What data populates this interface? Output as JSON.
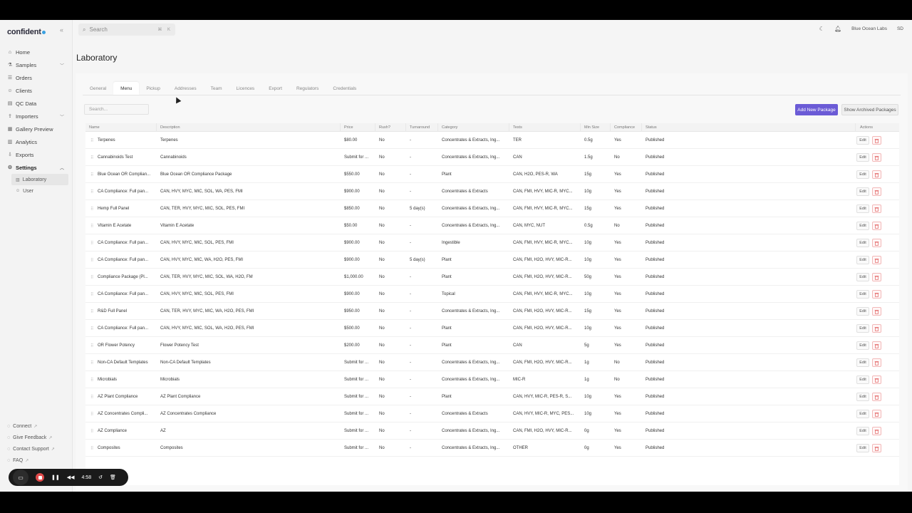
{
  "app": {
    "logo": "confident",
    "workspace": "Blue Ocean Labs",
    "user_initials": "SD"
  },
  "search": {
    "placeholder": "Search",
    "shortcut": "⌘ K"
  },
  "sidebar": {
    "items": [
      {
        "label": "Home",
        "icon": "home-icon"
      },
      {
        "label": "Samples",
        "icon": "flask-icon",
        "chevron": true
      },
      {
        "label": "Orders",
        "icon": "orders-icon"
      },
      {
        "label": "Clients",
        "icon": "clients-icon"
      },
      {
        "label": "QC Data",
        "icon": "qc-icon"
      },
      {
        "label": "Importers",
        "icon": "importers-icon",
        "chevron": true
      },
      {
        "label": "Gallery Preview",
        "icon": "gallery-icon"
      },
      {
        "label": "Analytics",
        "icon": "analytics-icon"
      },
      {
        "label": "Exports",
        "icon": "exports-icon"
      },
      {
        "label": "Settings",
        "icon": "gear-icon",
        "chevron": true,
        "active": true
      }
    ],
    "sub_items": [
      {
        "label": "Laboratory",
        "active": true
      },
      {
        "label": "User"
      }
    ],
    "footer": [
      {
        "label": "Connect"
      },
      {
        "label": "Give Feedback"
      },
      {
        "label": "Contact Support"
      },
      {
        "label": "FAQ"
      }
    ]
  },
  "page": {
    "title": "Laboratory"
  },
  "tabs": [
    "General",
    "Menu",
    "Pickup",
    "Addresses",
    "Team",
    "Licences",
    "Export",
    "Regulators",
    "Credentials"
  ],
  "active_tab": "Menu",
  "toolbar": {
    "search_placeholder": "Search...",
    "add_label": "Add New Package",
    "archived_label": "Show Archived Packages"
  },
  "table": {
    "columns": [
      "Name",
      "Description",
      "Price",
      "Rush?",
      "Turnaround",
      "Category",
      "Tests",
      "Min Size",
      "Compliance",
      "Status",
      "Actions"
    ],
    "edit_label": "Edit",
    "rows": [
      [
        "Terpenes",
        "Terpenes",
        "$80.00",
        "No",
        "-",
        "Concentrates & Extracts, Ing...",
        "TER",
        "0.5g",
        "Yes",
        "Published"
      ],
      [
        "Cannabinoids Test",
        "Cannabinoids",
        "Submit for ...",
        "No",
        "-",
        "Concentrates & Extracts, Ing...",
        "CAN",
        "1.5g",
        "No",
        "Published"
      ],
      [
        "Blue Ocean OR Complian...",
        "Blue Ocean OR Compliance Package",
        "$550.00",
        "No",
        "-",
        "Plant",
        "CAN, H2O, PES-R, WA",
        "15g",
        "Yes",
        "Published"
      ],
      [
        "CA Compliance: Full pan...",
        "CAN, HVY, MYC, MIC, SOL, WA, PES, FMI",
        "$900.00",
        "No",
        "-",
        "Concentrates & Extracts",
        "CAN, FMI, HVY, MIC-R, MYC...",
        "10g",
        "Yes",
        "Published"
      ],
      [
        "Hemp Full Panel",
        "CAN, TER, HVY, MYC, MIC, SOL, PES, FMI",
        "$850.00",
        "No",
        "5 day(s)",
        "Concentrates & Extracts, Ing...",
        "CAN, FMI, HVY, MIC-R, MYC...",
        "15g",
        "Yes",
        "Published"
      ],
      [
        "Vitamin E Acetate",
        "Vitamin E Acetate",
        "$50.00",
        "No",
        "-",
        "Concentrates & Extracts, Ing...",
        "CAN, MYC, NUT",
        "0.5g",
        "No",
        "Published"
      ],
      [
        "CA Compliance: Full pan...",
        "CAN, HVY, MYC, MIC, SOL, PES, FMI",
        "$900.00",
        "No",
        "-",
        "Ingestible",
        "CAN, FMI, HVY, MIC-R, MYC...",
        "10g",
        "Yes",
        "Published"
      ],
      [
        "CA Compliance: Full pan...",
        "CAN, HVY, MYC, MIC, WA, H2O, PES, FMI",
        "$900.00",
        "No",
        "5 day(s)",
        "Plant",
        "CAN, FMI, H2O, HVY, MIC-R...",
        "10g",
        "Yes",
        "Published"
      ],
      [
        "Compliance Package (Pl...",
        "CAN, TER, HVY, MYC, MIC, SOL, WA, H2O, FM",
        "$1,000.00",
        "No",
        "-",
        "Plant",
        "CAN, FMI, H2O, HVY, MIC-R...",
        "50g",
        "Yes",
        "Published"
      ],
      [
        "CA Compliance: Full pan...",
        "CAN, HVY, MYC, MIC, SOL, PES, FMI",
        "$900.00",
        "No",
        "-",
        "Topical",
        "CAN, FMI, HVY, MIC-R, MYC...",
        "10g",
        "Yes",
        "Published"
      ],
      [
        "R&D Full Panel",
        "CAN, TER, HVY, MYC, MIC, WA, H2O, PES, FMI",
        "$950.00",
        "No",
        "-",
        "Concentrates & Extracts, Ing...",
        "CAN, FMI, H2O, HVY, MIC-R...",
        "15g",
        "Yes",
        "Published"
      ],
      [
        "CA Compliance: Full pan...",
        "CAN, HVY, MYC, MIC, SOL, WA, H2O, PES, FMI",
        "$500.00",
        "No",
        "-",
        "Plant",
        "CAN, FMI, H2O, HVY, MIC-R...",
        "10g",
        "Yes",
        "Published"
      ],
      [
        "OR Flower Potency",
        "Flower Potency Test",
        "$200.00",
        "No",
        "-",
        "Plant",
        "CAN",
        "5g",
        "Yes",
        "Published"
      ],
      [
        "Non-CA Default Templates",
        "Non-CA Default Templates",
        "Submit for ...",
        "No",
        "-",
        "Concentrates & Extracts, Ing...",
        "CAN, FMI, H2O, HVY, MIC-R...",
        "1g",
        "No",
        "Published"
      ],
      [
        "Microbials",
        "Microbials",
        "Submit for ...",
        "No",
        "-",
        "Concentrates & Extracts, Ing...",
        "MIC-R",
        "1g",
        "No",
        "Published"
      ],
      [
        "AZ Plant Compliance",
        "AZ Plant Compliance",
        "Submit for ...",
        "No",
        "-",
        "Plant",
        "CAN, HVY, MIC-R, PES-R, S...",
        "10g",
        "Yes",
        "Published"
      ],
      [
        "AZ Concentrates Compli...",
        "AZ Concentrates Compliance",
        "Submit for ...",
        "No",
        "-",
        "Concentrates & Extracts",
        "CAN, HVY, MIC-R, MYC, PES...",
        "10g",
        "Yes",
        "Published"
      ],
      [
        "AZ Compliance",
        "AZ",
        "Submit for ...",
        "No",
        "-",
        "Concentrates & Extracts, Ing...",
        "CAN, FMI, H2O, HVY, MIC-R...",
        "0g",
        "Yes",
        "Published"
      ],
      [
        "Composites",
        "Composites",
        "Submit for ...",
        "No",
        "-",
        "Concentrates & Extracts, Ing...",
        "OTHER",
        "0g",
        "Yes",
        "Published"
      ]
    ]
  },
  "recorder": {
    "time": "4:58"
  }
}
